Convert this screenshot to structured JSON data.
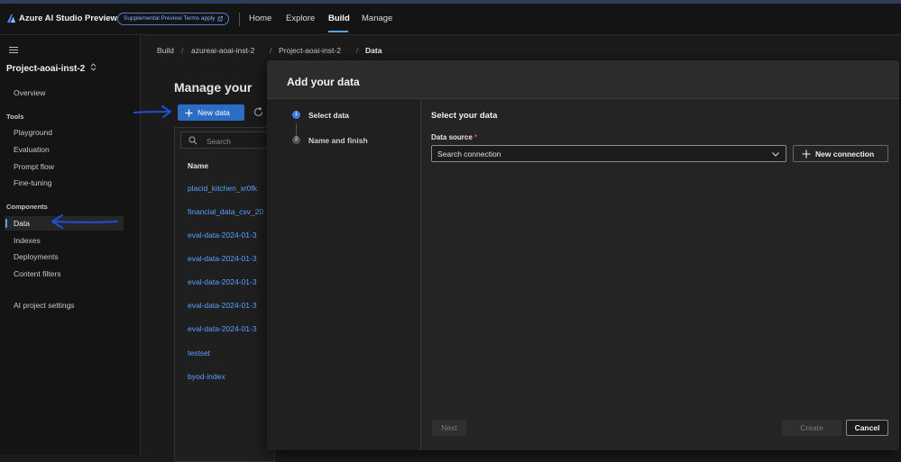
{
  "colors": {
    "accent": "#5aa0ff",
    "primary_button": "#2b6cc4",
    "annotation_arrow": "#1f4fd6",
    "required": "#e5484d"
  },
  "topbar": {
    "app_title": "Azure AI Studio Preview",
    "terms_badge": "Supplemental Preview Terms apply",
    "nav": [
      "Home",
      "Explore",
      "Build",
      "Manage"
    ],
    "active_nav": "Build"
  },
  "sidebar": {
    "project_name": "Project-aoai-inst-2",
    "overview": "Overview",
    "tools_heading": "Tools",
    "tools": [
      "Playground",
      "Evaluation",
      "Prompt flow",
      "Fine-tuning"
    ],
    "components_heading": "Components",
    "components": [
      "Data",
      "Indexes",
      "Deployments",
      "Content filters"
    ],
    "active_item": "Data",
    "settings": "AI project settings"
  },
  "breadcrumb": [
    "Build",
    "azureai-aoai-inst-2",
    "Project-aoai-inst-2",
    "Data"
  ],
  "page": {
    "title": "Manage your",
    "new_data_label": "New data",
    "search_placeholder": "Search",
    "column_name": "Name",
    "rows": [
      "placid_kitchen_xr0fk",
      "financial_data_csv_20",
      "eval-data-2024-01-3",
      "eval-data-2024-01-3",
      "eval-data-2024-01-3",
      "eval-data-2024-01-3",
      "eval-data-2024-01-3",
      "testset",
      "byod-index"
    ]
  },
  "modal": {
    "title": "Add your data",
    "steps": [
      {
        "number": "1",
        "label": "Select data",
        "state": "current"
      },
      {
        "number": "2",
        "label": "Name and finish",
        "state": "pending"
      }
    ],
    "section_title": "Select your data",
    "data_source_label": "Data source",
    "required_marker": "*",
    "select_value": "Search connection",
    "new_connection_label": "New connection",
    "next_label": "Next",
    "create_label": "Create",
    "cancel_label": "Cancel"
  }
}
